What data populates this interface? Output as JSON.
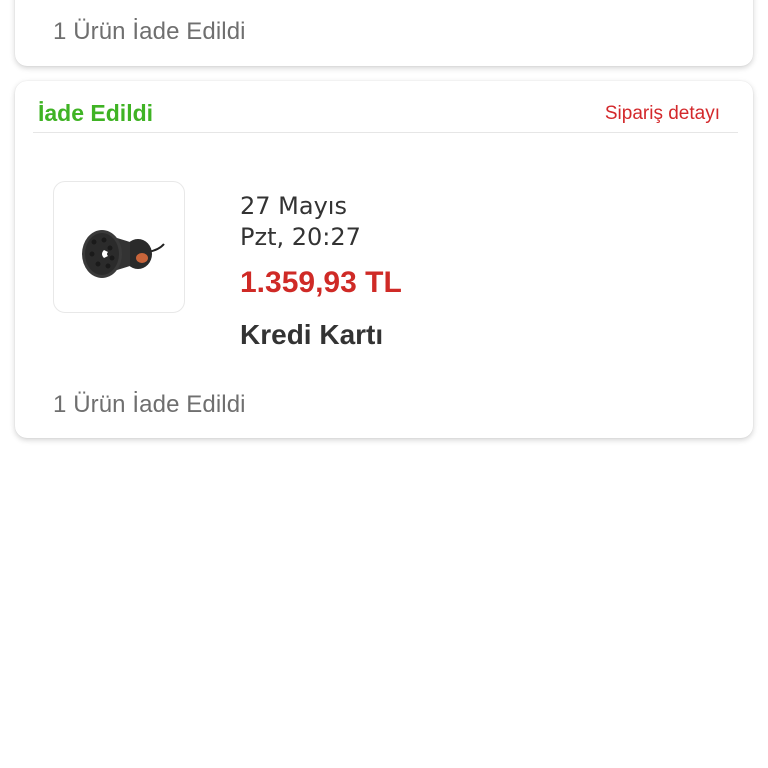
{
  "orders": [
    {
      "summary": "1 Ürün İade Edildi"
    },
    {
      "status": "İade Edildi",
      "detail_link": "Sipariş detayı",
      "date_line1": "27 Mayıs",
      "date_line2": "Pzt, 20:27",
      "price": "1.359,93 TL",
      "payment_method": "Kredi Kartı",
      "summary": "1 Ürün İade Edildi",
      "product_image_icon": "hair-dryer-diffuser-icon"
    }
  ],
  "colors": {
    "status_green": "#3fb324",
    "link_red": "#d3282b",
    "price_red": "#cf2a26",
    "text_dark": "#333333",
    "text_gray": "#6f6f6f"
  }
}
